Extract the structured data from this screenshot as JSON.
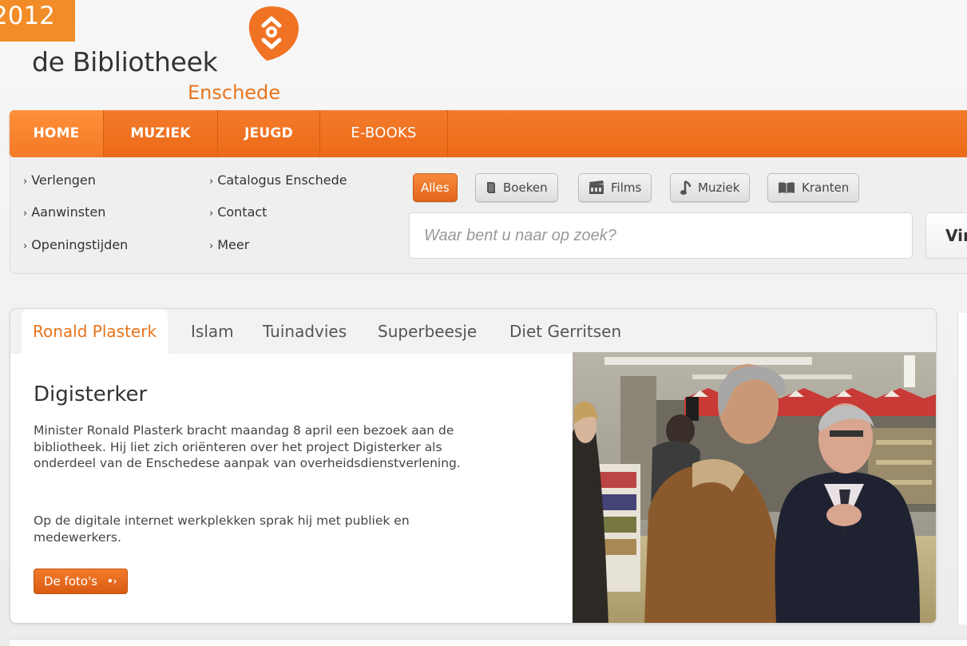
{
  "badge": {
    "year": "2012"
  },
  "logo": {
    "title": "de Bibliotheek",
    "city": "Enschede"
  },
  "nav": {
    "items": [
      {
        "label": "HOME",
        "active": true
      },
      {
        "label": "MUZIEK"
      },
      {
        "label": "JEUGD"
      },
      {
        "label": "E-BOOKS"
      }
    ]
  },
  "quick_links": {
    "col1": [
      "Verlengen",
      "Aanwinsten",
      "Openingstijden"
    ],
    "col2": [
      "Catalogus Enschede",
      "Contact",
      "Meer"
    ]
  },
  "search": {
    "filters": [
      {
        "label": "Alles",
        "active": true
      },
      {
        "label": "Boeken",
        "icon": "book-icon"
      },
      {
        "label": "Films",
        "icon": "film-icon"
      },
      {
        "label": "Muziek",
        "icon": "music-note-icon"
      },
      {
        "label": "Kranten",
        "icon": "newspaper-icon"
      }
    ],
    "placeholder": "Waar bent u naar op zoek?",
    "button_label": "Vind"
  },
  "feature": {
    "tabs": [
      "Ronald Plasterk",
      "Islam",
      "Tuinadvies",
      "Superbeesje",
      "Diet Gerritsen"
    ],
    "title": "Digisterker",
    "paragraph1": "Minister Ronald Plasterk bracht maandag 8 april een bezoek aan de bibliotheek. Hij liet zich oriënteren over het project Digisterker als onderdeel van de Enschedese aanpak van overheidsdienstverlening.",
    "paragraph2": "Op de digitale internet werkplekken sprak hij met publiek en medewerkers.",
    "button_label": "De foto's"
  },
  "colors": {
    "accent": "#f07324",
    "accent_dark": "#d95b12",
    "background": "#efefef"
  }
}
